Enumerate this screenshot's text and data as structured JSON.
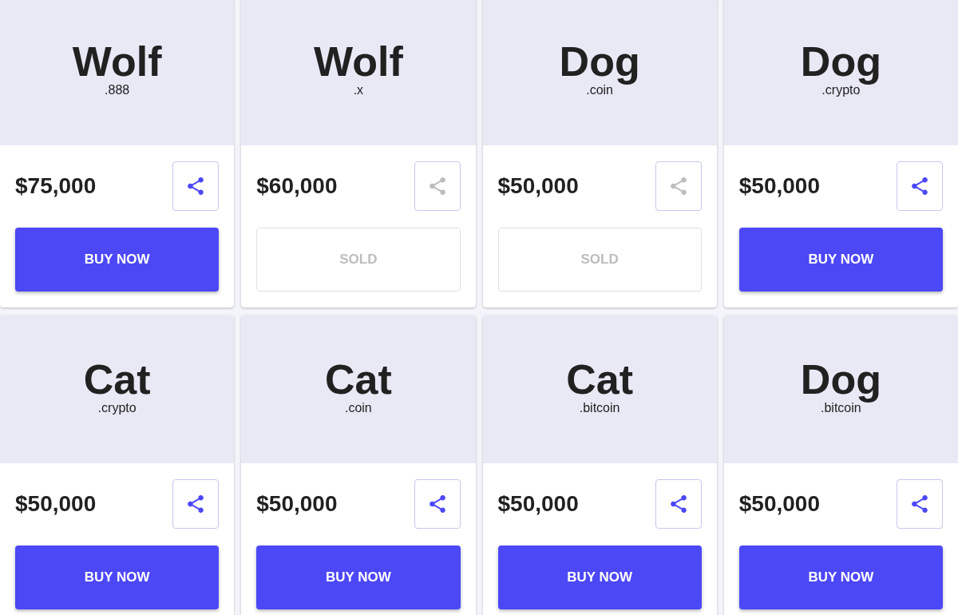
{
  "cards": [
    {
      "name": "Wolf",
      "extension": ".888",
      "price": "$75,000",
      "sold": false,
      "action": "BUY NOW"
    },
    {
      "name": "Wolf",
      "extension": ".x",
      "price": "$60,000",
      "sold": true,
      "action": "SOLD"
    },
    {
      "name": "Dog",
      "extension": ".coin",
      "price": "$50,000",
      "sold": true,
      "action": "SOLD"
    },
    {
      "name": "Dog",
      "extension": ".crypto",
      "price": "$50,000",
      "sold": false,
      "action": "BUY NOW"
    },
    {
      "name": "Cat",
      "extension": ".crypto",
      "price": "$50,000",
      "sold": false,
      "action": "BUY NOW"
    },
    {
      "name": "Cat",
      "extension": ".coin",
      "price": "$50,000",
      "sold": false,
      "action": "BUY NOW"
    },
    {
      "name": "Cat",
      "extension": ".bitcoin",
      "price": "$50,000",
      "sold": false,
      "action": "BUY NOW"
    },
    {
      "name": "Dog",
      "extension": ".bitcoin",
      "price": "$50,000",
      "sold": false,
      "action": "BUY NOW"
    }
  ]
}
